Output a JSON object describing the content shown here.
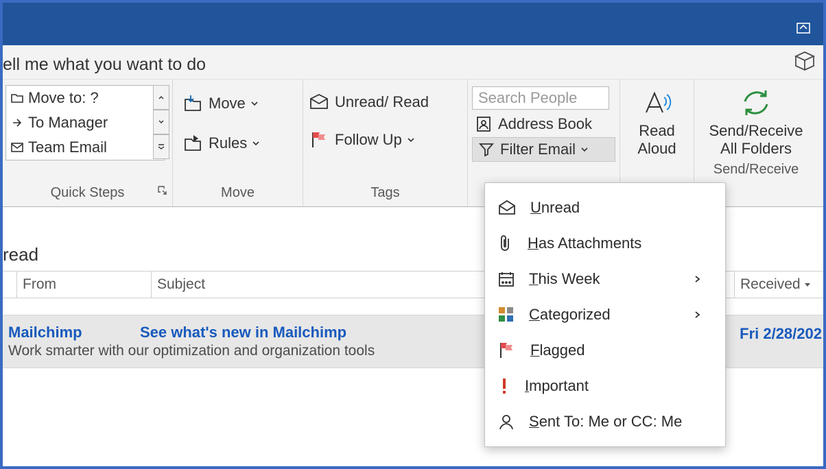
{
  "tellme": "ell me what you want to do",
  "quicksteps": {
    "label": "Quick Steps",
    "items": [
      "Move to: ?",
      "To Manager",
      "Team Email"
    ]
  },
  "move": {
    "label": "Move",
    "move_btn": "Move",
    "rules_btn": "Rules"
  },
  "tags": {
    "label": "Tags",
    "unread_read": "Unread/ Read",
    "followup": "Follow Up"
  },
  "find": {
    "search_placeholder": "Search People",
    "address_book": "Address Book",
    "filter_email": "Filter Email"
  },
  "read_aloud": {
    "l1": "Read",
    "l2": "Aloud"
  },
  "sendrecv": {
    "l1": "Send/Receive",
    "l2": "All Folders",
    "label": "Send/Receive"
  },
  "columns": {
    "read_title": "read",
    "from": "From",
    "subject": "Subject",
    "received": "Received"
  },
  "message": {
    "from": "Mailchimp",
    "subject": "See what's new in Mailchimp",
    "preview": "Work smarter with our optimization and organization tools",
    "date": "Fri 2/28/202"
  },
  "filter_menu": {
    "unread": "nread",
    "has_attach": "as Attachments",
    "this_week": "his Week",
    "categorized": "ategorized",
    "flagged": "lagged",
    "important": "mportant",
    "sent_to": "ent To: Me or CC: Me"
  }
}
